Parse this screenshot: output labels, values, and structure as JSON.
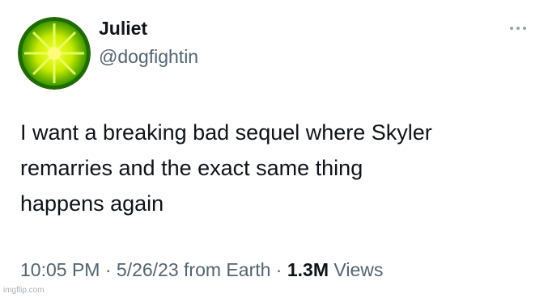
{
  "author": {
    "display_name": "Juliet",
    "handle": "@dogfightin",
    "avatar_icon": "limewire-logo-icon",
    "avatar_colors": {
      "outer": "#8fd400",
      "inner": "#f7f700",
      "ring": "#1f6b00"
    }
  },
  "more_icon": "more-horizontal-icon",
  "tweet": {
    "text": "I want a breaking bad sequel where Skyler\nremarries and the exact same thing\nhappens again"
  },
  "meta": {
    "time": "10:05 PM",
    "separator": " · ",
    "date": "5/26/23",
    "source": " from Earth",
    "views_count": "1.3M",
    "views_label": " Views"
  },
  "watermark": "imgflip.com",
  "colors": {
    "text_primary": "#0f1419",
    "text_secondary": "#536471",
    "background": "#ffffff"
  }
}
